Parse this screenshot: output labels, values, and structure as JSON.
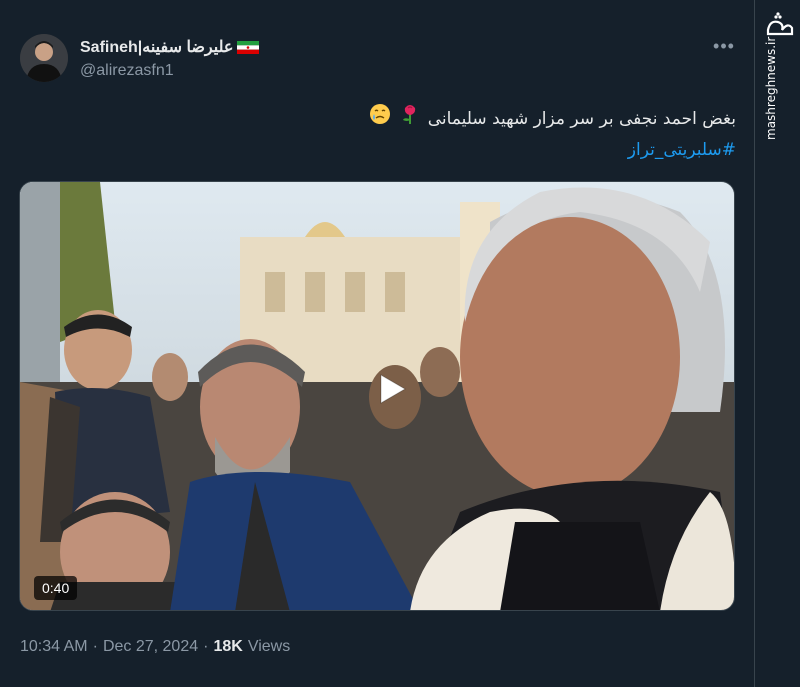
{
  "tweet": {
    "author": {
      "display_name": "Safineh|علیرضا سفینه",
      "handle": "@alirezasfn1",
      "flag_icon": "iran-flag-icon"
    },
    "text_line1": "بغض احمد نجفی بر سر مزار شهید سلیمانی",
    "hashtag": "#سلبریتی_تراز",
    "emoji_icons": [
      "rose-icon",
      "crying-face-icon"
    ],
    "media": {
      "kind": "video",
      "duration": "0:40"
    },
    "timestamp": {
      "time": "10:34 AM",
      "date": "Dec 27, 2024",
      "views_count": "18K",
      "views_label": "Views",
      "separator": "·"
    }
  },
  "watermark": {
    "logo_text": "مشرق",
    "site": "mashreghnews.ir"
  },
  "colors": {
    "background": "#15202b",
    "link": "#1d9bf0",
    "secondary_text": "#8b98a5",
    "primary_text": "#e7e9ea"
  }
}
